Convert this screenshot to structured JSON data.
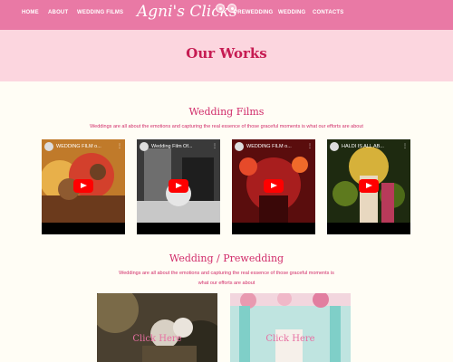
{
  "nav": {
    "left_links": [
      "HOME",
      "ABOUT",
      "WEDDING FILMS"
    ],
    "brand": "Agni's Clicks",
    "right_links": [
      "PREWEDDING",
      "WEDDING",
      "CONTACTS"
    ]
  },
  "banner": {
    "title": "Our Works"
  },
  "films": {
    "title": "Wedding Films",
    "text": "Weddings are all about the emotions and capturing the real essence of those graceful moments is what our efforts are about",
    "videos": [
      {
        "title": "WEDDING FILM o..."
      },
      {
        "title": "Wedding Film Of..."
      },
      {
        "title": "WEDDING FILM o..."
      },
      {
        "title": "HALDI IS ALL AB..."
      }
    ]
  },
  "prewedding": {
    "title": "Wedding / Prewedding",
    "text_line1": "Weddings are all about the emotions and capturing the real essence of those graceful moments is",
    "text_line2": "what our efforts are about",
    "cards": [
      {
        "label": "Click Here"
      },
      {
        "label": "Click Here"
      }
    ]
  },
  "colors": {
    "nav": "#e979a5",
    "banner": "#fcd6df",
    "accent": "#d12c6a",
    "title": "#c61b52"
  }
}
